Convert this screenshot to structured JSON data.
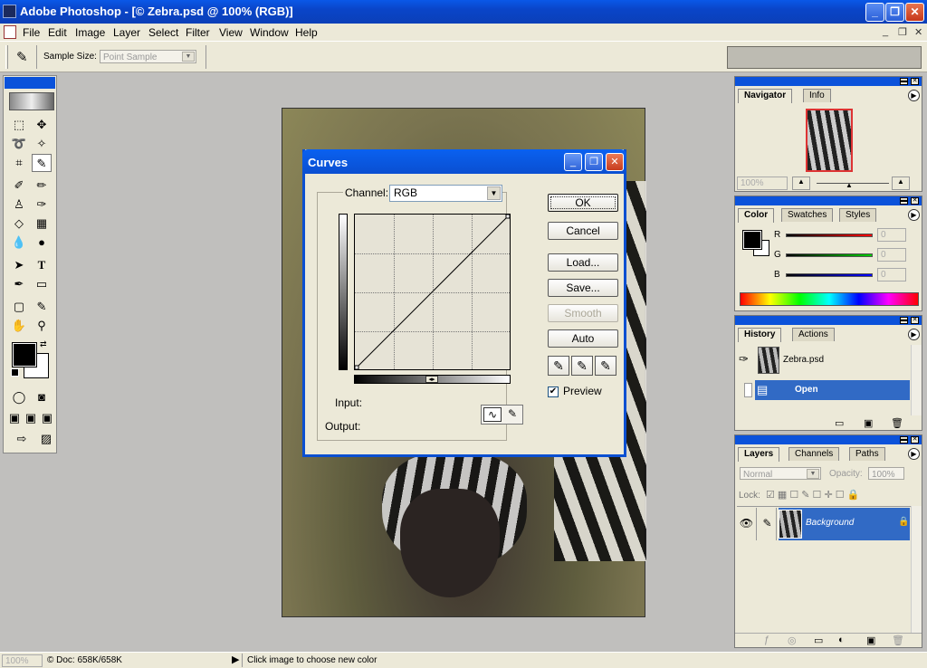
{
  "window": {
    "title": "Adobe Photoshop - [© Zebra.psd @ 100% (RGB)]",
    "minimize_glyph": "_",
    "maximize_glyph": "❐",
    "close_glyph": "✕"
  },
  "menubar": {
    "items": [
      "File",
      "Edit",
      "Image",
      "Layer",
      "Select",
      "Filter",
      "View",
      "Window",
      "Help"
    ],
    "doc_controls": [
      "_",
      "❐",
      "✕"
    ]
  },
  "options_bar": {
    "sample_size_label": "Sample Size:",
    "sample_size_value": "Point Sample"
  },
  "curves_dialog": {
    "title": "Curves",
    "channel_label": "Channel:",
    "channel_value": "RGB",
    "buttons": {
      "ok": "OK",
      "cancel": "Cancel",
      "load": "Load...",
      "save": "Save...",
      "smooth": "Smooth",
      "auto": "Auto"
    },
    "preview_label": "Preview",
    "preview_checked": true,
    "input_label": "Input:",
    "output_label": "Output:"
  },
  "navigator_panel": {
    "tabs": [
      "Navigator",
      "Info"
    ],
    "zoom": "100%"
  },
  "color_panel": {
    "tabs": [
      "Color",
      "Swatches",
      "Styles"
    ],
    "channels": [
      {
        "label": "R",
        "value": "0",
        "color": "#ff0000"
      },
      {
        "label": "G",
        "value": "0",
        "color": "#00c000"
      },
      {
        "label": "B",
        "value": "0",
        "color": "#0000ff"
      }
    ]
  },
  "history_panel": {
    "tabs": [
      "History",
      "Actions"
    ],
    "snapshot": "Zebra.psd",
    "states": [
      "Open"
    ]
  },
  "layers_panel": {
    "tabs": [
      "Layers",
      "Channels",
      "Paths"
    ],
    "blend_mode": "Normal",
    "opacity_label": "Opacity:",
    "opacity_value": "100%",
    "lock_label": "Lock:",
    "layers": [
      "Background"
    ]
  },
  "statusbar": {
    "zoom": "100%",
    "doc_info": "© Doc: 658K/658K",
    "hint": "Click image to choose new color"
  },
  "colors": {
    "titlebar": "#0a4fd1",
    "chrome": "#ece9d8",
    "selection": "#316ac5"
  }
}
